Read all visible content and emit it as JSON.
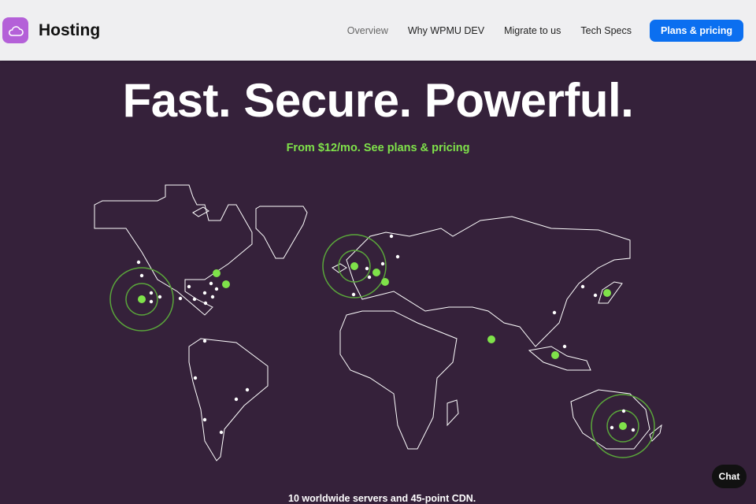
{
  "header": {
    "brand": "Hosting",
    "logo_icon": "cloud-icon",
    "nav": [
      "Overview",
      "Why WPMU DEV",
      "Migrate to us",
      "Tech Specs"
    ],
    "cta": "Plans & pricing"
  },
  "hero": {
    "title": "Fast. Secure. Powerful.",
    "subtitle": "From $12/mo. See plans & pricing",
    "accent": "#7fe24a"
  },
  "footer_text": "10 worldwide servers and 45-point CDN.",
  "chat_label": "Chat"
}
